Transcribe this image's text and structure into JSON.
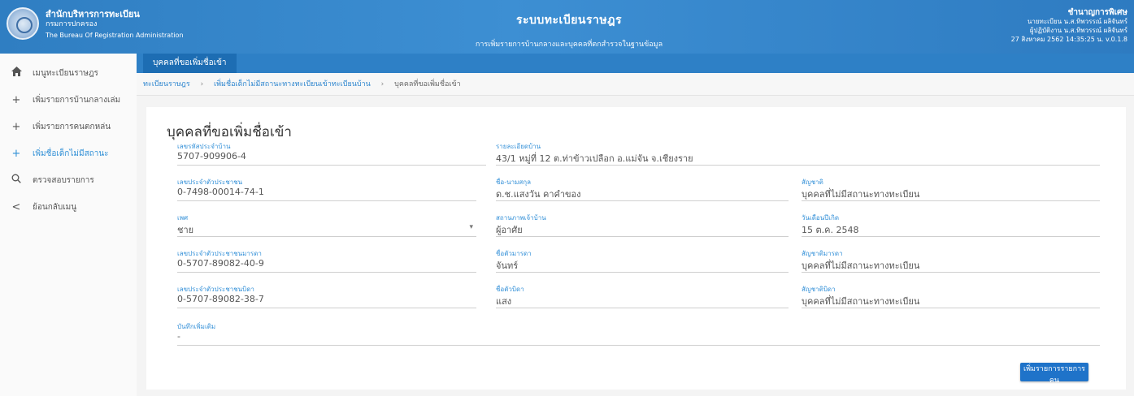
{
  "header": {
    "org_line1": "สำนักบริหารการทะเบียน",
    "org_line2": "กรมการปกครอง",
    "org_line3": "The Bureau Of Registration Administration",
    "system_title": "ระบบทะเบียนราษฎร",
    "subtitle": "การเพิ่มรายการบ้านกลางและบุคคลที่ตกสำรวจในฐานข้อมูล",
    "user_name": "ชำนาญการพิเศษ",
    "user_line2": "นายทะเบียน น.ส.ทิพวรรณ์ ผลิจันทร์",
    "user_line3": "ผู้ปฏิบัติงาน น.ส.ทิพวรรณ์ ผลิจันทร์",
    "datetime_version": "27 สิงหาคม 2562 14:35:25 น. v.0.1.8"
  },
  "tab": {
    "label": "บุคคลที่ขอเพิ่มชื่อเข้า"
  },
  "sidebar": {
    "items": [
      {
        "icon": "home-icon",
        "label": "เมนูทะเบียนราษฎร"
      },
      {
        "icon": "plus-icon",
        "label": "เพิ่มรายการบ้านกลางเล่ม"
      },
      {
        "icon": "plus-icon",
        "label": "เพิ่มรายการคนตกหล่น"
      },
      {
        "icon": "plus-icon",
        "label": "เพิ่มชื่อเด็กไม่มีสถานะ"
      },
      {
        "icon": "search-icon",
        "label": "ตรวจสอบรายการ"
      },
      {
        "icon": "back-icon",
        "label": "ย้อนกลับเมนู"
      }
    ]
  },
  "breadcrumb": {
    "item1": "ทะเบียนราษฎร",
    "item2": "เพิ่มชื่อเด็กไม่มีสถานะทางทะเบียนเข้าทะเบียนบ้าน",
    "current": "บุคคลที่ขอเพิ่มชื่อเข้า"
  },
  "page_title": "บุคคลที่ขอเพิ่มชื่อเข้า",
  "form": {
    "house_code": {
      "label": "เลขรหัสประจำบ้าน",
      "value": "5707-909906-4"
    },
    "address": {
      "label": "รายละเอียดบ้าน",
      "value": "43/1 หมู่ที่ 12 ต.ท่าข้าวเปลือก อ.แม่จัน จ.เชียงราย"
    },
    "id_number": {
      "label": "เลขประจำตัวประชาชน",
      "value": "0-7498-00014-74-1"
    },
    "full_name": {
      "label": "ชื่อ-นามสกุล",
      "value": "ด.ช.แสงวัน คาคำของ"
    },
    "nationality": {
      "label": "สัญชาติ",
      "value": "บุคคลที่ไม่มีสถานะทางทะเบียน"
    },
    "gender": {
      "label": "เพศ",
      "value": "ชาย"
    },
    "house_status": {
      "label": "สถานภาพเจ้าบ้าน",
      "value": "ผู้อาศัย"
    },
    "birth_date": {
      "label": "วันเดือนปีเกิด",
      "value": "15 ต.ค. 2548"
    },
    "mother_id": {
      "label": "เลขประจำตัวประชาชนมารดา",
      "value": "0-5707-89082-40-9"
    },
    "mother_name": {
      "label": "ชื่อตัวมารดา",
      "value": "จันทร์"
    },
    "mother_nationality": {
      "label": "สัญชาติมารดา",
      "value": "บุคคลที่ไม่มีสถานะทางทะเบียน"
    },
    "father_id": {
      "label": "เลขประจำตัวประชาชนบิดา",
      "value": "0-5707-89082-38-7"
    },
    "father_name": {
      "label": "ชื่อตัวบิดา",
      "value": "แสง"
    },
    "father_nationality": {
      "label": "สัญชาติบิดา",
      "value": "บุคคลที่ไม่มีสถานะทางทะเบียน"
    },
    "note": {
      "label": "บันทึกเพิ่มเติม",
      "value": "-"
    }
  },
  "actions": {
    "save_label": "เพิ่มรายการรายการคน"
  }
}
